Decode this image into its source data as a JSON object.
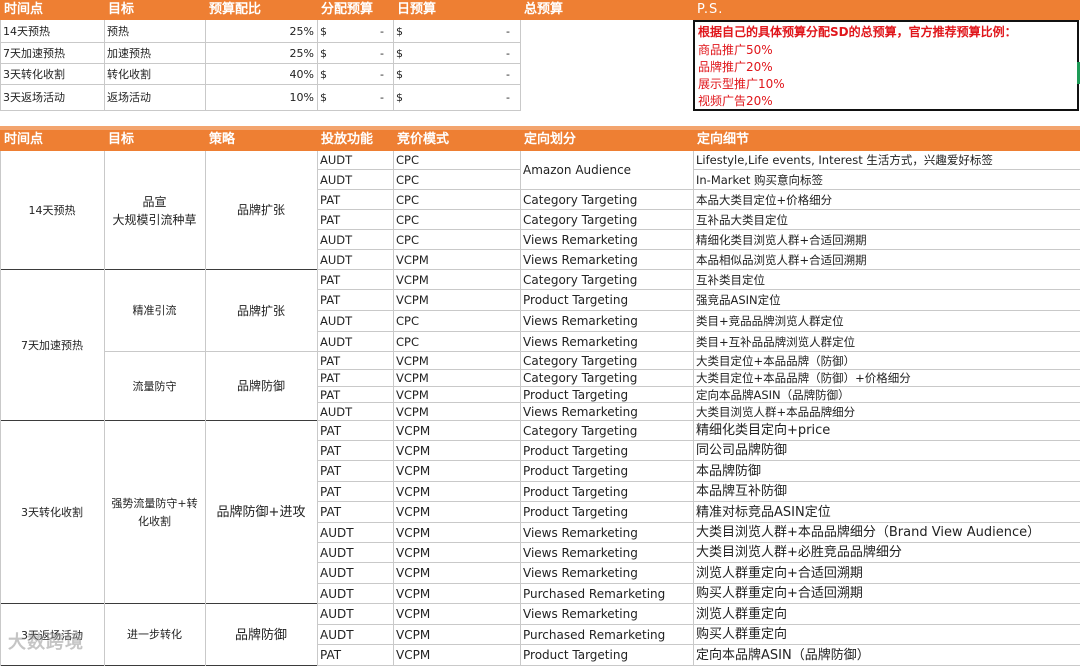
{
  "top_header": [
    "时间点",
    "目标",
    "预算配比",
    "分配预算",
    "日预算",
    "总预算",
    "P.S."
  ],
  "top_rows": [
    {
      "time": "14天预热",
      "goal": "预热",
      "ratio": "25%",
      "alloc_sym": "$",
      "alloc_val": "-",
      "daily_sym": "$",
      "daily_val": "-"
    },
    {
      "time": "7天加速预热",
      "goal": "加速预热",
      "ratio": "25%",
      "alloc_sym": "$",
      "alloc_val": "-",
      "daily_sym": "$",
      "daily_val": "-"
    },
    {
      "time": "3天转化收割",
      "goal": "转化收割",
      "ratio": "40%",
      "alloc_sym": "$",
      "alloc_val": "-",
      "daily_sym": "$",
      "daily_val": "-"
    },
    {
      "time": "3天返场活动",
      "goal": "返场活动",
      "ratio": "10%",
      "alloc_sym": "$",
      "alloc_val": "-",
      "daily_sym": "$",
      "daily_val": "-"
    }
  ],
  "ps_lines": [
    "根据自己的具体预算分配SD的总预算，官方推荐预算比例：",
    "商品推广50%",
    "品牌推广20%",
    "展示型推广10%",
    "视频广告20%"
  ],
  "main_header": [
    "时间点",
    "目标",
    "策略",
    "投放功能",
    "竞价模式",
    "定向划分",
    "定向细节"
  ],
  "groups": [
    {
      "time": "14天预热",
      "subgroups": [
        {
          "goal": "品宣\n大规模引流种草",
          "strategy": "品牌扩张"
        }
      ]
    },
    {
      "time": "7天加速预热",
      "subgroups": [
        {
          "goal": "精准引流",
          "strategy": "品牌扩张"
        },
        {
          "goal": "流量防守",
          "strategy": "品牌防御"
        }
      ]
    },
    {
      "time": "3天转化收割",
      "subgroups": [
        {
          "goal": "强势流量防守+转化收割",
          "strategy": "品牌防御+进攻"
        }
      ]
    },
    {
      "time": "3天返场活动",
      "subgroups": [
        {
          "goal": "进一步转化",
          "strategy": "品牌防御"
        }
      ]
    }
  ],
  "rows": [
    {
      "func": "AUDT",
      "bid": "CPC",
      "target": "Amazon Audience",
      "detail": "Lifestyle,Life events, Interest 生活方式，兴趣爱好标签"
    },
    {
      "func": "AUDT",
      "bid": "CPC",
      "target": "",
      "detail": "In-Market 购买意向标签"
    },
    {
      "func": "PAT",
      "bid": "CPC",
      "target": "Category Targeting",
      "detail": "本品大类目定位+价格细分"
    },
    {
      "func": "PAT",
      "bid": "CPC",
      "target": "Category Targeting",
      "detail": "互补品大类目定位"
    },
    {
      "func": "AUDT",
      "bid": "CPC",
      "target": "Views Remarketing",
      "detail": "精细化类目浏览人群+合适回溯期"
    },
    {
      "func": "AUDT",
      "bid": "VCPM",
      "target": "Views Remarketing",
      "detail": "本品相似品浏览人群+合适回溯期"
    },
    {
      "func": "PAT",
      "bid": "VCPM",
      "target": "Category Targeting",
      "detail": "互补类目定位"
    },
    {
      "func": "PAT",
      "bid": "VCPM",
      "target": "Product Targeting",
      "detail": "强竞品ASIN定位"
    },
    {
      "func": "AUDT",
      "bid": "CPC",
      "target": "Views Remarketing",
      "detail": "类目+竞品品牌浏览人群定位"
    },
    {
      "func": "AUDT",
      "bid": "CPC",
      "target": "Views Remarketing",
      "detail": "类目+互补品品牌浏览人群定位"
    },
    {
      "func": "PAT",
      "bid": "VCPM",
      "target": "Category Targeting",
      "detail": "大类目定位+本品品牌（防御）"
    },
    {
      "func": "PAT",
      "bid": "VCPM",
      "target": "Category Targeting",
      "detail": "大类目定位+本品品牌（防御）+价格细分"
    },
    {
      "func": "PAT",
      "bid": "VCPM",
      "target": "Product Targeting",
      "detail": "定向本品牌ASIN（品牌防御）"
    },
    {
      "func": "AUDT",
      "bid": "VCPM",
      "target": "Views Remarketing",
      "detail": "大类目浏览人群+本品品牌细分"
    },
    {
      "func": "PAT",
      "bid": "VCPM",
      "target": "Category Targeting",
      "detail": "精细化类目定向+price"
    },
    {
      "func": "PAT",
      "bid": "VCPM",
      "target": "Product Targeting",
      "detail": "同公司品牌防御"
    },
    {
      "func": "PAT",
      "bid": "VCPM",
      "target": "Product Targeting",
      "detail": "本品牌防御"
    },
    {
      "func": "PAT",
      "bid": "VCPM",
      "target": "Product Targeting",
      "detail": "本品牌互补防御"
    },
    {
      "func": "PAT",
      "bid": "VCPM",
      "target": "Product Targeting",
      "detail": "精准对标竞品ASIN定位"
    },
    {
      "func": "AUDT",
      "bid": "VCPM",
      "target": "Views Remarketing",
      "detail": "大类目浏览人群+本品品牌细分（Brand View Audience）"
    },
    {
      "func": "AUDT",
      "bid": "VCPM",
      "target": "Views Remarketing",
      "detail": "大类目浏览人群+必胜竞品品牌细分"
    },
    {
      "func": "AUDT",
      "bid": "VCPM",
      "target": "Views Remarketing",
      "detail": "浏览人群重定向+合适回溯期"
    },
    {
      "func": "AUDT",
      "bid": "VCPM",
      "target": "Purchased Remarketing",
      "detail": "购买人群重定向+合适回溯期"
    },
    {
      "func": "AUDT",
      "bid": "VCPM",
      "target": "Views Remarketing",
      "detail": "浏览人群重定向"
    },
    {
      "func": "AUDT",
      "bid": "VCPM",
      "target": "Purchased Remarketing",
      "detail": "购买人群重定向"
    },
    {
      "func": "PAT",
      "bid": "VCPM",
      "target": "Product Targeting",
      "detail": "定向本品牌ASIN（品牌防御）"
    }
  ],
  "watermark": "大数跨境"
}
